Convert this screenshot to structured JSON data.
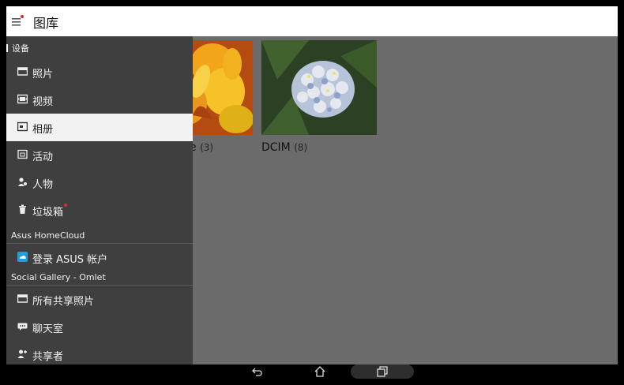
{
  "app": {
    "title": "图库"
  },
  "drawer": {
    "sections": [
      {
        "header": "设备",
        "items": [
          {
            "label": "照片",
            "icon": "photo-icon"
          },
          {
            "label": "视频",
            "icon": "film-icon"
          },
          {
            "label": "相册",
            "icon": "album-icon",
            "selected": true
          },
          {
            "label": "活动",
            "icon": "event-icon"
          },
          {
            "label": "人物",
            "icon": "people-icon"
          },
          {
            "label": "垃圾箱",
            "icon": "trash-icon",
            "badge": true
          }
        ]
      },
      {
        "header": "Asus HomeCloud",
        "items": [
          {
            "label": "登录 ASUS 帐户",
            "icon": "cloud-icon"
          }
        ]
      },
      {
        "header": "Social Gallery - Omlet",
        "items": [
          {
            "label": "所有共享照片",
            "icon": "shared-photos-icon"
          },
          {
            "label": "聊天室",
            "icon": "chat-icon"
          },
          {
            "label": "共享者",
            "icon": "sharer-icon"
          }
        ]
      }
    ]
  },
  "albums": [
    {
      "name_partial": "e",
      "count": "(3)"
    },
    {
      "name": "DCIM",
      "count": "(8)"
    }
  ],
  "colors": {
    "badge": "#e02b2b",
    "drawer_bg": "#3f3f3f",
    "selected_bg": "#f2f2f2",
    "cloud_icon": "#1fa0dc"
  },
  "navbar": {
    "buttons": [
      "back-icon",
      "home-icon",
      "recents-icon"
    ]
  }
}
